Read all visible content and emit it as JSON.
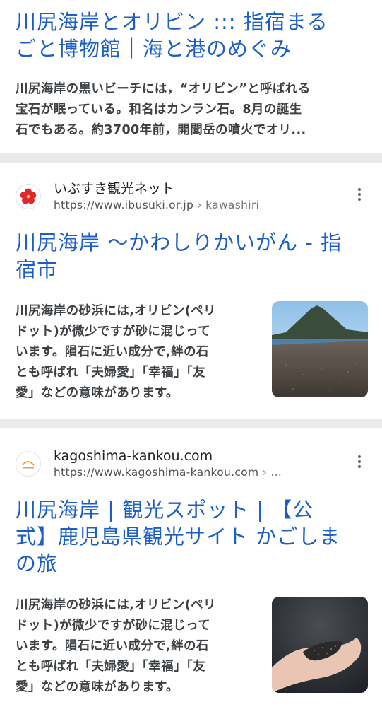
{
  "results": [
    {
      "title_lines": [
        "川尻海岸とオリビン ::: 指宿まる",
        "ごと博物館｜海と港のめぐみ"
      ],
      "snippet_lines": [
        "川尻海岸の黒いビーチには，“オリビン”と呼ばれる",
        "宝石が眠っている。和名はカンラン石。8月の誕生",
        "石でもある。約3700年前，開聞岳の噴火でオリ..."
      ]
    },
    {
      "site_name": "いぶすき観光ネット",
      "url": "https://www.ibusuki.or.jp",
      "breadcrumb": "› kawashiri",
      "favicon": "hibiscus-icon",
      "title_lines": [
        "川尻海岸 ～かわしりかいがん - 指",
        "宿市"
      ],
      "snippet_lines": [
        "川尻海岸の砂浜には,オリビン(ペリ",
        "ドット)が微少ですが砂に混じって",
        "います。隕石に近い成分で,絆の石",
        "とも呼ばれ「夫婦愛」「幸福」「友",
        "愛」などの意味があります。"
      ],
      "thumbnail": "beach-volcano-photo"
    },
    {
      "site_name": "kagoshima-kankou.com",
      "url": "https://www.kagoshima-kankou.com",
      "breadcrumb": "› ...",
      "favicon": "kagoshima-logo-icon",
      "title_lines": [
        "川尻海岸 | 観光スポット | 【公",
        "式】鹿児島県観光サイト かごしま",
        "の旅"
      ],
      "snippet_lines": [
        "川尻海岸の砂浜には,オリビン(ペリ",
        "ドット)が微少ですが砂に混じって",
        "います。隕石に近い成分で,絆の石",
        "とも呼ばれ「夫婦愛」「幸福」「友",
        "愛」などの意味があります。"
      ],
      "thumbnail": "hand-holding-sand-photo"
    }
  ],
  "colors": {
    "link": "#1a5ec6",
    "text": "#3c4043",
    "separator": "#e9eaec"
  }
}
